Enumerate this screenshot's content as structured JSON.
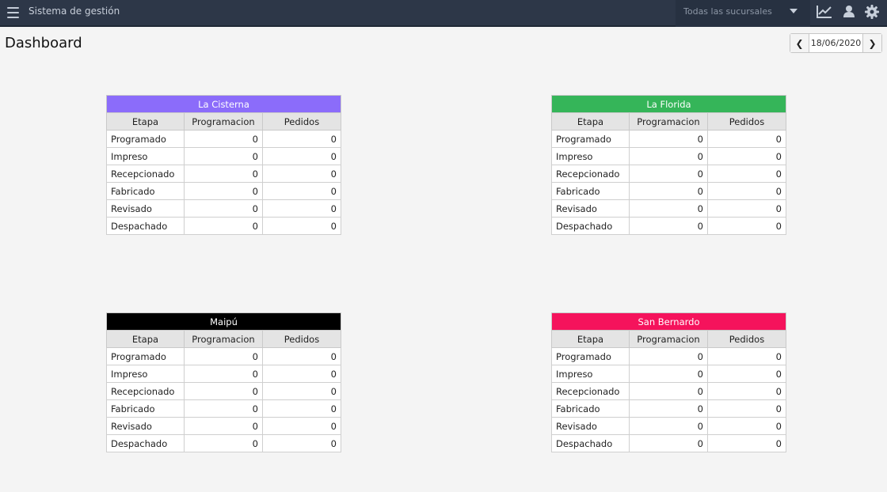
{
  "header": {
    "app_title": "Sistema de gestión",
    "branch_selector": {
      "selected": "Todas las sucursales"
    },
    "icons": [
      "menu-icon",
      "chevron-down-icon",
      "chart-line-icon",
      "user-icon",
      "gear-icon"
    ]
  },
  "page": {
    "title": "Dashboard",
    "date": "18/06/2020"
  },
  "columns": {
    "stage": "Etapa",
    "programacion": "Programacion",
    "pedidos": "Pedidos"
  },
  "branches": [
    {
      "name": "La Cisterna",
      "color": "#8b6cfa",
      "rows": [
        {
          "stage": "Programado",
          "programacion": "0",
          "pedidos": "0"
        },
        {
          "stage": "Impreso",
          "programacion": "0",
          "pedidos": "0"
        },
        {
          "stage": "Recepcionado",
          "programacion": "0",
          "pedidos": "0"
        },
        {
          "stage": "Fabricado",
          "programacion": "0",
          "pedidos": "0"
        },
        {
          "stage": "Revisado",
          "programacion": "0",
          "pedidos": "0"
        },
        {
          "stage": "Despachado",
          "programacion": "0",
          "pedidos": "0"
        }
      ]
    },
    {
      "name": "La Florida",
      "color": "#35b559",
      "rows": [
        {
          "stage": "Programado",
          "programacion": "0",
          "pedidos": "0"
        },
        {
          "stage": "Impreso",
          "programacion": "0",
          "pedidos": "0"
        },
        {
          "stage": "Recepcionado",
          "programacion": "0",
          "pedidos": "0"
        },
        {
          "stage": "Fabricado",
          "programacion": "0",
          "pedidos": "0"
        },
        {
          "stage": "Revisado",
          "programacion": "0",
          "pedidos": "0"
        },
        {
          "stage": "Despachado",
          "programacion": "0",
          "pedidos": "0"
        }
      ]
    },
    {
      "name": "Maipú",
      "color": "#000000",
      "rows": [
        {
          "stage": "Programado",
          "programacion": "0",
          "pedidos": "0"
        },
        {
          "stage": "Impreso",
          "programacion": "0",
          "pedidos": "0"
        },
        {
          "stage": "Recepcionado",
          "programacion": "0",
          "pedidos": "0"
        },
        {
          "stage": "Fabricado",
          "programacion": "0",
          "pedidos": "0"
        },
        {
          "stage": "Revisado",
          "programacion": "0",
          "pedidos": "0"
        },
        {
          "stage": "Despachado",
          "programacion": "0",
          "pedidos": "0"
        }
      ]
    },
    {
      "name": "San Bernardo",
      "color": "#f5135c",
      "rows": [
        {
          "stage": "Programado",
          "programacion": "0",
          "pedidos": "0"
        },
        {
          "stage": "Impreso",
          "programacion": "0",
          "pedidos": "0"
        },
        {
          "stage": "Recepcionado",
          "programacion": "0",
          "pedidos": "0"
        },
        {
          "stage": "Fabricado",
          "programacion": "0",
          "pedidos": "0"
        },
        {
          "stage": "Revisado",
          "programacion": "0",
          "pedidos": "0"
        },
        {
          "stage": "Despachado",
          "programacion": "0",
          "pedidos": "0"
        }
      ]
    }
  ]
}
